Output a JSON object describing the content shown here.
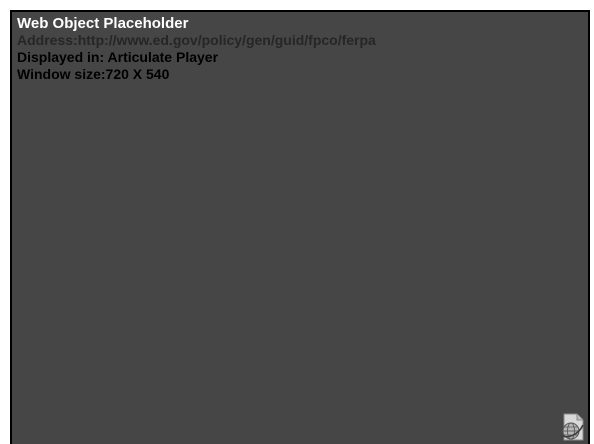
{
  "placeholder": {
    "title": "Web Object Placeholder",
    "address_label": "Address:",
    "address": "http://www.ed.gov/policy/gen/guid/fpco/ferpa",
    "displayed_label": "Displayed in: ",
    "displayed_in": "Articulate Player",
    "window_label": "Window size:",
    "window_size": "720 X 540"
  },
  "icons": {
    "corner": "web-object-globe-icon"
  },
  "colors": {
    "background": "#464646",
    "border": "#000000",
    "title": "#ffffff",
    "address": "#262626",
    "text": "#000000"
  }
}
